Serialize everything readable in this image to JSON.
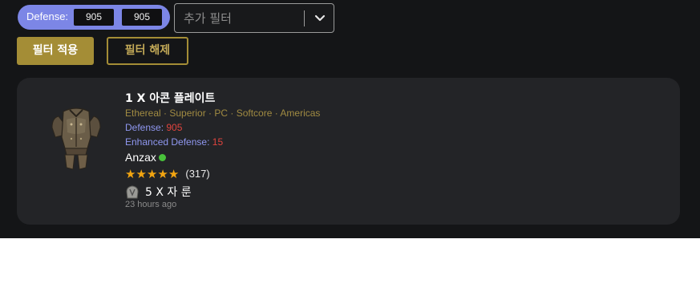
{
  "filter": {
    "label": "Defense:",
    "min": "905",
    "dash": "-",
    "max": "905",
    "add_filter_placeholder": "추가 필터"
  },
  "buttons": {
    "apply": "필터 적용",
    "clear": "필터 해제"
  },
  "listing": {
    "title": "1 X 아콘 플레이트",
    "meta": "Ethereal · Superior · PC · Softcore · Americas",
    "properties": [
      {
        "key": "Defense:",
        "value": "905"
      },
      {
        "key": "Enhanced Defense:",
        "value": "15"
      }
    ],
    "seller": "Anzax",
    "seller_status": "online",
    "rating_stars": 5,
    "rating_count": "(317)",
    "price": "5 X 자 룬",
    "posted": "23 hours ago"
  },
  "colors": {
    "gold": "#a48d36",
    "pill": "#7c86e6",
    "star": "#f2a511",
    "online": "#49c23b",
    "value_red": "#e0443e"
  },
  "icons": [
    "chevron-down-icon",
    "armor-item-image",
    "rune-icon",
    "star-icon",
    "online-dot"
  ]
}
